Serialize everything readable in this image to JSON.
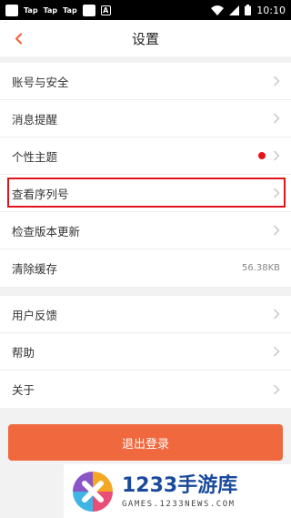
{
  "status_bar": {
    "notifications": [
      "Tap",
      "Tap",
      "Tap"
    ],
    "a_badge": "A",
    "time": "10:10"
  },
  "header": {
    "title": "设置"
  },
  "group1": [
    {
      "label": "账号与安全"
    },
    {
      "label": "消息提醒"
    },
    {
      "label": "个性主题"
    },
    {
      "label": "查看序列号"
    },
    {
      "label": "检查版本更新"
    },
    {
      "label": "清除缓存",
      "value": "56.38KB"
    }
  ],
  "group2": [
    {
      "label": "用户反馈"
    },
    {
      "label": "帮助"
    },
    {
      "label": "关于"
    }
  ],
  "logout_label": "退出登录",
  "watermark": {
    "brand": "1233手游库",
    "domain": "GAMES.1233NEWS.COM"
  },
  "colors": {
    "accent": "#f0683d",
    "highlight": "#e0151c",
    "dot": "#e8141c"
  }
}
